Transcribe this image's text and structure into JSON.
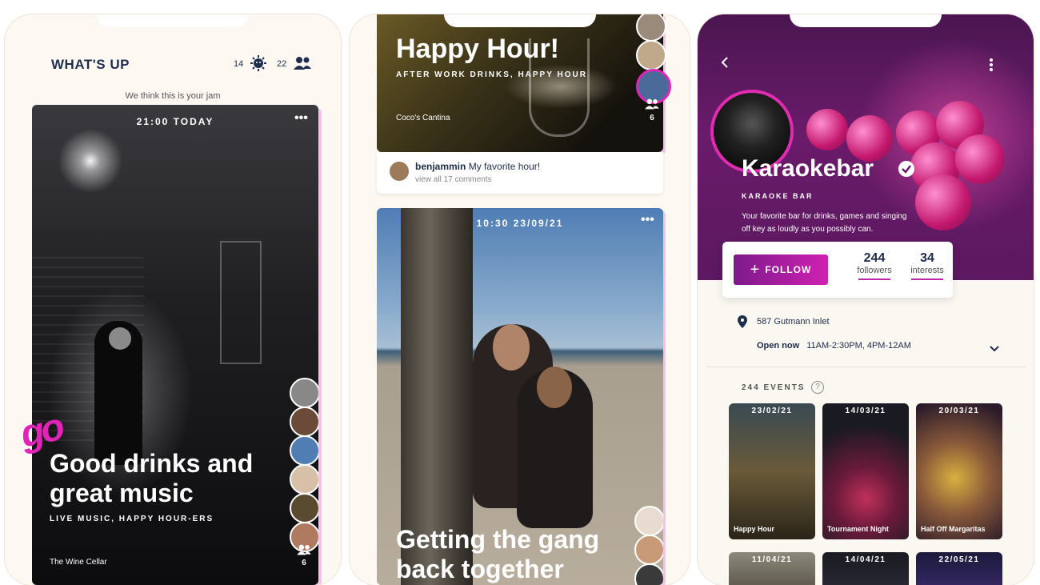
{
  "feed": {
    "title": "WHAT'S UP",
    "stat1": "14",
    "stat2": "22",
    "subtitle": "We think this is your jam",
    "card": {
      "time": "21:00 TODAY",
      "title_line1": "Good drinks and",
      "title_line2": "great music",
      "tags": "LIVE MUSIC, HAPPY HOUR-ERS",
      "venue": "The Wine Cellar",
      "attendee_count": "6"
    },
    "logo_text": "go"
  },
  "event_feed": {
    "card1": {
      "title": "Happy Hour!",
      "tags": "AFTER WORK DRINKS, HAPPY HOUR",
      "venue": "Coco's Cantina",
      "attendee_count": "6",
      "comment_user": "benjammin",
      "comment_text": "My favorite hour!",
      "view_comments": "view all 17 comments"
    },
    "card2": {
      "datetime": "10:30 23/09/21",
      "title_line1": "Getting the gang",
      "title_line2": "back together"
    }
  },
  "venue": {
    "name": "Karaokebar",
    "category": "KARAOKE BAR",
    "description_line1": "Your favorite bar for drinks, games and singing",
    "description_line2": "off key as loudly as you possibly can.",
    "follow_label": "FOLLOW",
    "followers_count": "244",
    "followers_label": "followers",
    "interests_count": "34",
    "interests_label": "interests",
    "address": "587 Gutmann Inlet",
    "open_status": "Open now",
    "hours": "11AM-2:30PM, 4PM-12AM",
    "events_header": "244 EVENTS",
    "events": [
      {
        "date": "23/02/21",
        "name": "Happy Hour"
      },
      {
        "date": "14/03/21",
        "name": "Tournament Night"
      },
      {
        "date": "20/03/21",
        "name": "Half Off Margaritas"
      }
    ],
    "events_row2": [
      {
        "date": "11/04/21"
      },
      {
        "date": "14/04/21"
      },
      {
        "date": "22/05/21"
      }
    ]
  },
  "colors": {
    "accent": "#e024b8",
    "navy": "#1f2d4d",
    "hero": "#6a1b6a"
  }
}
